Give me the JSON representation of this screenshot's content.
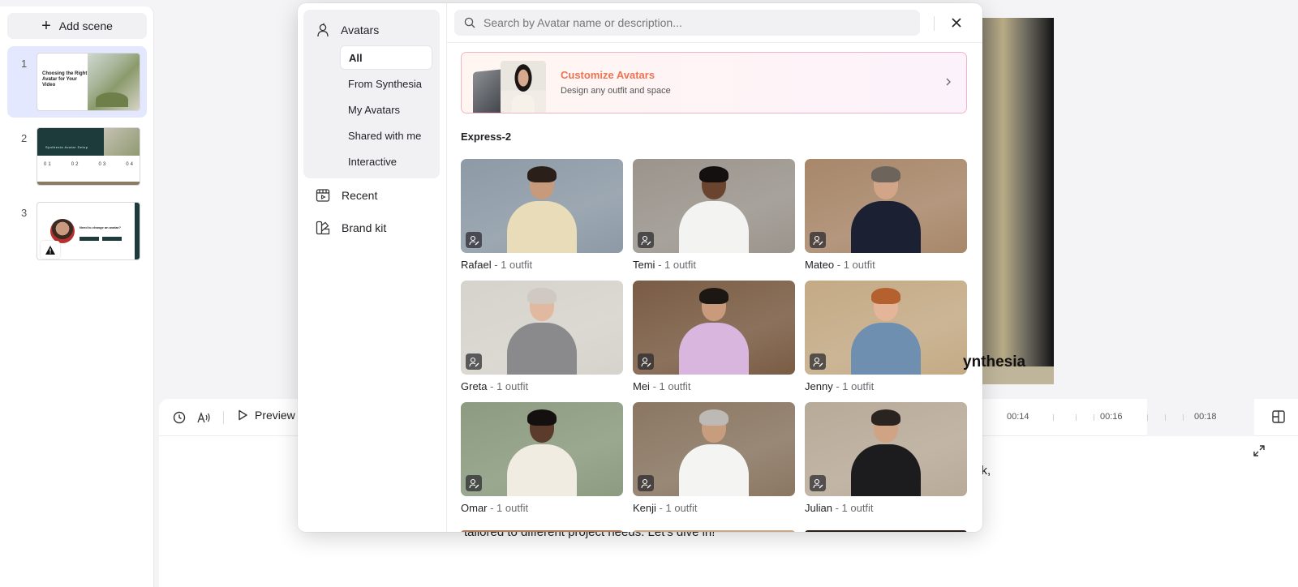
{
  "sidebar": {
    "add_scene_label": "Add scene",
    "scenes": [
      {
        "number": "1",
        "thumb_text": "Choosing the Right Avatar for Your Video"
      },
      {
        "number": "2",
        "thumb_label": "Synthesia Avatar Setup",
        "thumb_nums": [
          "01",
          "02",
          "03",
          "04"
        ]
      },
      {
        "number": "3",
        "thumb_text": "Need to change an avatar?"
      }
    ]
  },
  "canvas": {
    "brand_text": "ynthesia"
  },
  "timeline": {
    "preview_label": "Preview",
    "ticks": [
      "00:14",
      "00:16",
      "00:18"
    ],
    "script_text": "tailored to different project needs. Let's dive in!",
    "script_tail": "ck,"
  },
  "modal": {
    "nav": {
      "avatars_label": "Avatars",
      "sub_items": [
        "All",
        "From Synthesia",
        "My Avatars",
        "Shared with me",
        "Interactive"
      ],
      "recent_label": "Recent",
      "brand_kit_label": "Brand kit"
    },
    "search": {
      "placeholder": "Search by Avatar name or description..."
    },
    "promo": {
      "title": "Customize Avatars",
      "subtitle": "Design any outfit and space"
    },
    "section_title": "Express-2",
    "avatars": [
      {
        "name": "Rafael",
        "outfit": " - 1 outfit",
        "bg": "#8d9aa6",
        "skin": "#c79a7c",
        "hair": "#2b2019",
        "shirt": "#e8dcb9"
      },
      {
        "name": "Temi",
        "outfit": " - 1 outfit",
        "bg": "#9a948c",
        "skin": "#6b4430",
        "hair": "#141010",
        "shirt": "#f3f3f1"
      },
      {
        "name": "Mateo",
        "outfit": " - 1 outfit",
        "bg": "#a8876a",
        "skin": "#d2a588",
        "hair": "#6d645c",
        "shirt": "#1b2133"
      },
      {
        "name": "Greta",
        "outfit": " - 1 outfit",
        "bg": "#d6d3cc",
        "skin": "#e0b9a0",
        "hair": "#cfc9c1",
        "shirt": "#8a8a8c"
      },
      {
        "name": "Mei",
        "outfit": " - 1 outfit",
        "bg": "#7a5c44",
        "skin": "#c99a7c",
        "hair": "#1d1714",
        "shirt": "#d9b6dd"
      },
      {
        "name": "Jenny",
        "outfit": " - 1 outfit",
        "bg": "#c4aa85",
        "skin": "#e4b598",
        "hair": "#b5602f",
        "shirt": "#6f8fb1"
      },
      {
        "name": "Omar",
        "outfit": " - 1 outfit",
        "bg": "#8c9b80",
        "skin": "#5b3b2a",
        "hair": "#141010",
        "shirt": "#f1ece2"
      },
      {
        "name": "Kenji",
        "outfit": " - 1 outfit",
        "bg": "#8a7662",
        "skin": "#c89d7e",
        "hair": "#bdb9b4",
        "shirt": "#f4f4f2"
      },
      {
        "name": "Julian",
        "outfit": " - 1 outfit",
        "bg": "#b8aa98",
        "skin": "#d0a384",
        "hair": "#2a2420",
        "shirt": "#1c1c1e"
      }
    ],
    "colors": {
      "promo_accent": "#ee7354",
      "active_scene": "#e4e8ff"
    }
  }
}
